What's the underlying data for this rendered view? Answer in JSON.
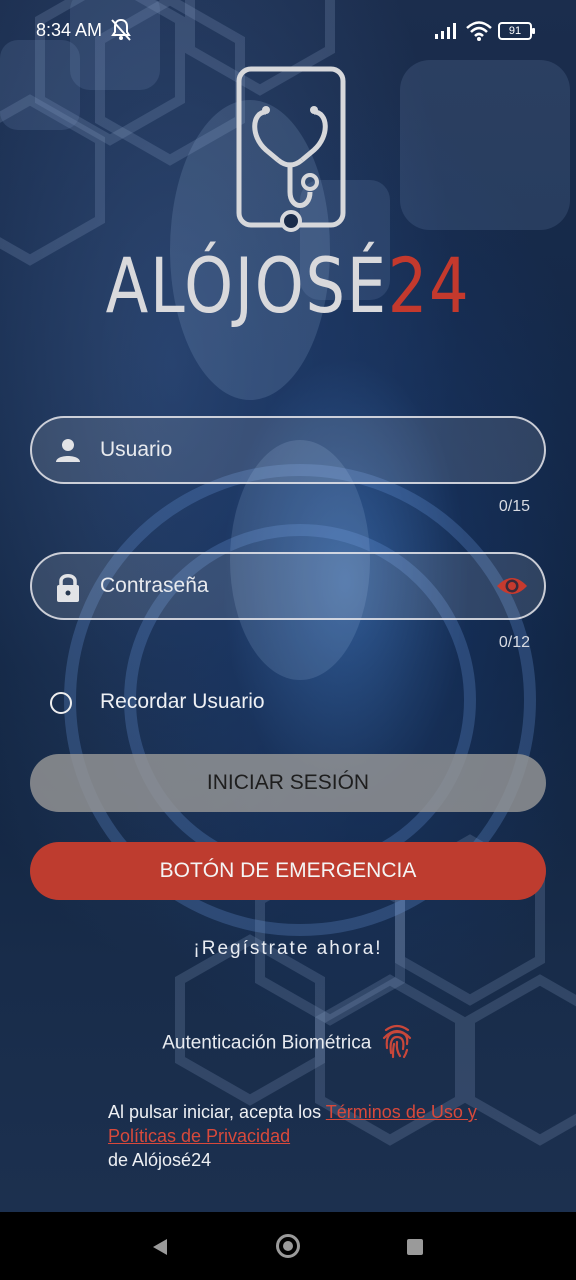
{
  "status_bar": {
    "time": "8:34 AM",
    "battery": "91",
    "icons": [
      "notifications-off-icon",
      "signal-icon",
      "wifi-icon",
      "battery-icon"
    ]
  },
  "brand": {
    "name_part1": "ALÓJOSÉ",
    "name_part2": "24",
    "logo_icon": "phone-stethoscope-icon",
    "colors": {
      "light": "#d9d9dc",
      "accent": "#c4392d"
    }
  },
  "login": {
    "username_placeholder": "Usuario",
    "username_counter": "0/15",
    "username_icon": "user-icon",
    "password_placeholder": "Contraseña",
    "password_counter": "0/12",
    "password_icon": "lock-icon",
    "toggle_visibility_icon": "eye-icon",
    "remember_label": "Recordar Usuario",
    "login_button": "INICIAR SESIÓN",
    "emergency_button": "BOTÓN DE EMERGENCIA",
    "register_link": "¡Regístrate ahora!",
    "biometric_label": "Autenticación Biométrica",
    "biometric_icon": "fingerprint-icon"
  },
  "terms": {
    "prefix": "Al pulsar iniciar, acepta los ",
    "link": "Términos de Uso y Políticas de Privacidad",
    "suffix": " de Alójosé24"
  },
  "nav_bar": {
    "icons": [
      "back-icon",
      "home-icon",
      "recent-apps-icon"
    ]
  },
  "colors": {
    "emergency": "#be3c2f",
    "login_button": "#969696",
    "link": "#d8493b"
  }
}
